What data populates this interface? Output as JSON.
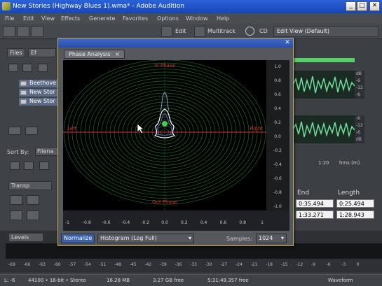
{
  "window": {
    "title": "New Stories (Highway Blues 1).wma* - Adobe Audition",
    "min": "_",
    "max": "□",
    "close": "✕"
  },
  "menu": [
    "File",
    "Edit",
    "View",
    "Effects",
    "Generate",
    "Favorites",
    "Options",
    "Window",
    "Help"
  ],
  "toolbar": {
    "edit_label": "Edit",
    "multitrack_label": "Multitrack",
    "cd_label": "CD",
    "workspace": "Edit View (Default)"
  },
  "left_panel": {
    "tabs": [
      "Files",
      "Ef"
    ],
    "files": [
      "Beethove",
      "New Stor",
      "New Stor"
    ],
    "sort_by_label": "Sort By:",
    "sort_by_value": "Filena",
    "transport_tab": "Transp"
  },
  "dialog": {
    "tab_label": "Phase Analysis",
    "left_label": "Left",
    "right_label": "Right",
    "in_phase_label": "In Phase",
    "out_phase_label": "Out Phase",
    "x_ticks": [
      "-1",
      "-0.8",
      "-0.6",
      "-0.4",
      "-0.2",
      "0.0",
      "0.2",
      "0.4",
      "0.6",
      "0.8",
      "1"
    ],
    "y_ticks": [
      "1.0",
      "0.8",
      "0.6",
      "0.4",
      "0.2",
      "0.0",
      "-0.2",
      "-0.4",
      "-0.6",
      "-0.8",
      "-1.0"
    ],
    "normalize_label": "Normalize",
    "mode_value": "Histogram (Log Full)",
    "samples_label": "Samples:",
    "samples_value": "1024"
  },
  "right_panel": {
    "db_ticks_top": [
      "dB",
      "-6",
      "-12",
      "-6"
    ],
    "db_ticks_bottom": [
      "-6",
      "-12",
      "-6",
      "dB"
    ],
    "time_label": "1:20",
    "hms_label": "hms (m)",
    "end_label": "End",
    "length_label": "Length",
    "end_values": [
      "0:35.494",
      "1:33.271"
    ],
    "length_values": [
      "0:25.494",
      "1:28.943"
    ]
  },
  "levels": {
    "tab_label": "Levels",
    "scale": [
      "-69",
      "-66",
      "-63",
      "-60",
      "-57",
      "-54",
      "-51",
      "-48",
      "-45",
      "-42",
      "-39",
      "-36",
      "-33",
      "-30",
      "-27",
      "-24",
      "-21",
      "-18",
      "-15",
      "-12",
      "-9",
      "-6",
      "-3",
      "0"
    ]
  },
  "status": {
    "lr": "L: -6",
    "format": "44100 • 16-bit • Stereo",
    "size": "16.28 MB",
    "free": "3.27 GB free",
    "free_time": "5:31:49.357 free",
    "view": "Waveform"
  },
  "colors": {
    "accent": "#2b63d8",
    "scope_green": "#1f6a2a",
    "axis_red": "#d83030"
  }
}
